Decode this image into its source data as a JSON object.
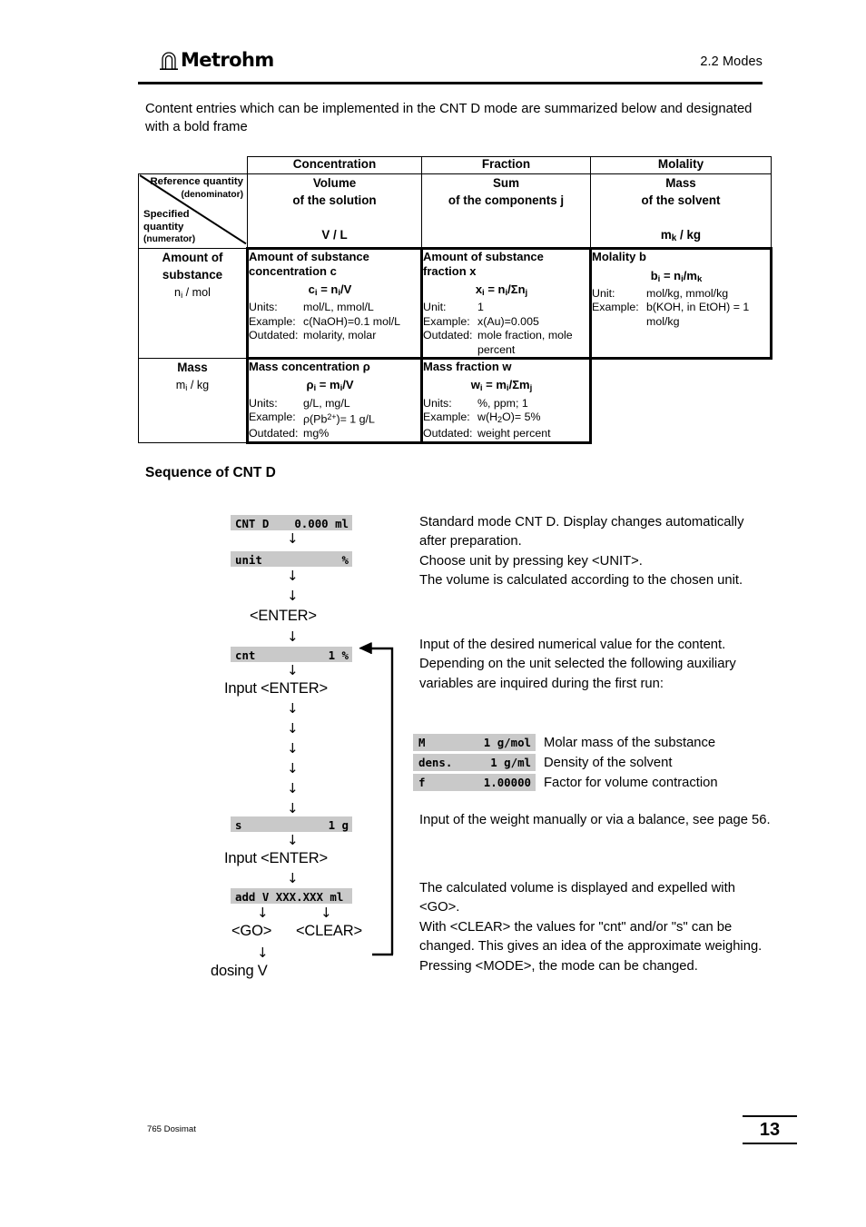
{
  "header": {
    "logo_text": "Metrohm",
    "logo_icon": "metrohm-arch-logo",
    "section": "2.2 Modes"
  },
  "intro": "Content entries which can be implemented in the CNT D mode are summarized below and designated with a bold frame",
  "table": {
    "column_headers": [
      "Concentration",
      "Fraction",
      "Molality"
    ],
    "corner": {
      "top_label": "Reference quantity",
      "top_sub": "(denominator)",
      "bottom_label_1": "Specified",
      "bottom_label_2": "quantity",
      "bottom_sub": "(numerator)"
    },
    "reference_row": [
      {
        "line1": "Volume",
        "line2": "of the solution",
        "symbol": "V / L"
      },
      {
        "line1": "Sum",
        "line2": "of the components j",
        "symbol": ""
      },
      {
        "line1": "Mass",
        "line2": "of the solvent",
        "symbol": "mk / kg"
      }
    ],
    "rows": [
      {
        "row_header": {
          "line1": "Amount of",
          "line2": "substance",
          "unit": "ni / mol"
        },
        "cells": [
          {
            "title": "Amount of substance concentration c",
            "formula": "ci = ni/V",
            "entries": [
              {
                "key": "Units:",
                "value": "mol/L, mmol/L"
              },
              {
                "key": "Example:",
                "value": "c(NaOH)=0.1 mol/L"
              },
              {
                "key": "Outdated:",
                "value": "molarity, molar"
              }
            ],
            "bold_frame": true
          },
          {
            "title": "Amount of substance fraction x",
            "formula": "xi = ni/Σnj",
            "entries": [
              {
                "key": "Unit:",
                "value": "1"
              },
              {
                "key": "Example:",
                "value": "x(Au)=0.005"
              },
              {
                "key": "Outdated:",
                "value": "mole fraction, mole",
                "cont": "percent"
              }
            ],
            "bold_frame": true
          },
          {
            "title": "Molality b",
            "formula": "bi = ni/mk",
            "entries": [
              {
                "key": "Unit:",
                "value": "mol/kg, mmol/kg"
              },
              {
                "key": "Example:",
                "value": "b(KOH, in EtOH) = 1",
                "cont": "mol/kg"
              }
            ],
            "bold_frame": true
          }
        ]
      },
      {
        "row_header": {
          "line1": "Mass",
          "line2": "",
          "unit": "mi / kg"
        },
        "cells": [
          {
            "title": "Mass concentration ρ",
            "formula": "ρi = mi/V",
            "entries": [
              {
                "key": "Units:",
                "value": "g/L, mg/L"
              },
              {
                "key": "Example:",
                "value": "ρ(Pb2+)= 1 g/L"
              },
              {
                "key": "Outdated:",
                "value": "mg%"
              }
            ],
            "bold_frame": true
          },
          {
            "title": "Mass fraction w",
            "formula": "wi = mi/Σmj",
            "entries": [
              {
                "key": "Units:",
                "value": "%, ppm; 1"
              },
              {
                "key": "Example:",
                "value": "w(H2O)= 5%"
              },
              {
                "key": "Outdated:",
                "value": "weight percent"
              }
            ],
            "bold_frame": true
          },
          {
            "title": "",
            "formula": "",
            "entries": [],
            "bold_frame": false,
            "empty": true
          }
        ]
      }
    ]
  },
  "sequence": {
    "heading": "Sequence of CNT D",
    "displays": {
      "cnt_d": {
        "left": "CNT D",
        "right": "0.000 ml"
      },
      "unit": {
        "left": "unit",
        "right": "%"
      },
      "cnt": {
        "left": "cnt",
        "right": "1 %"
      },
      "s": {
        "left": "s",
        "right": "1 g"
      },
      "add_v": {
        "left": "add V XXX.XXX ml",
        "right": ""
      }
    },
    "keys": {
      "enter_1": "<ENTER>",
      "input_enter_1": "Input <ENTER>",
      "input_enter_2": "Input <ENTER>",
      "go": "<GO>",
      "clear": "<CLEAR>",
      "dosing": "dosing V"
    }
  },
  "annotations": {
    "block1": "Standard mode CNT D. Display changes automatically after preparation.\nChoose unit by pressing key <UNIT>.\nThe volume is calculated according to the chosen unit.",
    "block2": "Input of the desired numerical value for the content.\nDepending on the unit selected the following auxiliary variables are inquired during the first run:",
    "aux": [
      {
        "disp_left": "M",
        "disp_right": "1 g/mol",
        "label": "Molar mass of the substance"
      },
      {
        "disp_left": "dens.",
        "disp_right": "1 g/ml",
        "label": "Density of the solvent"
      },
      {
        "disp_left": "f",
        "disp_right": "1.00000",
        "label": "Factor for volume contraction"
      }
    ],
    "block3": "Input of the weight manually or via a balance, see page 56.",
    "block4": "The calculated volume is displayed and expelled with <GO>.\nWith <CLEAR> the values for \"cnt\" and/or \"s\" can be changed. This gives an idea of the approximate weighing.\nPressing <MODE>, the mode can be changed."
  },
  "footer": {
    "left": "765 Dosimat",
    "page_number": "13"
  },
  "colors": {
    "display_background": "#c9c9c9",
    "rule": "#000000",
    "text": "#000000"
  }
}
